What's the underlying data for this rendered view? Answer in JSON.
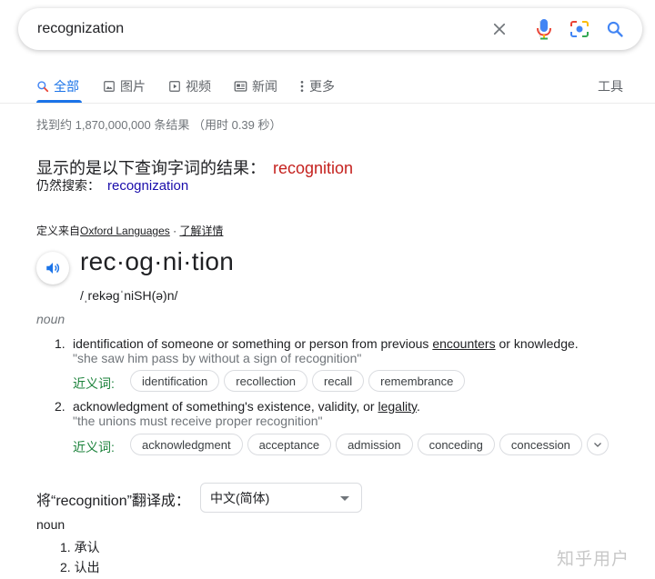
{
  "search": {
    "query": "recognization"
  },
  "tabs": [
    {
      "label": "全部",
      "icon": "search-icon",
      "active": true
    },
    {
      "label": "图片",
      "icon": "image-icon"
    },
    {
      "label": "视频",
      "icon": "video-icon"
    },
    {
      "label": "新闻",
      "icon": "news-icon"
    },
    {
      "label": "更多",
      "icon": "more-icon"
    }
  ],
  "tools_label": "工具",
  "result_stats": "找到约 1,870,000,000 条结果 （用时 0.39 秒）",
  "spelling": {
    "showing_prefix": "显示的是以下查询字词的结果：",
    "corrected": "recognition",
    "still_prefix": "仍然搜索：",
    "original": "recognization"
  },
  "dictionary": {
    "source_prefix": "定义来自",
    "source_link": "Oxford Languages",
    "sep": " · ",
    "more_link": "了解详情",
    "headword": "rec·og·ni·tion",
    "phonetic": "/ˌrekəɡˈniSH(ə)n/",
    "pos": "noun",
    "senses": [
      {
        "num": "1.",
        "def_before": "identification of someone or something or person from previous ",
        "def_link": "encounters",
        "def_after": " or knowledge.",
        "example": "\"she saw him pass by without a sign of recognition\"",
        "syn_label": "近义词:",
        "synonyms": [
          "identification",
          "recollection",
          "recall",
          "remembrance"
        ]
      },
      {
        "num": "2.",
        "def_before": "acknowledgment of something's existence, validity, or ",
        "def_link": "legality",
        "def_after": ".",
        "example": "\"the unions must receive proper recognition\"",
        "syn_label": "近义词:",
        "synonyms": [
          "acknowledgment",
          "acceptance",
          "admission",
          "conceding",
          "concession"
        ]
      }
    ]
  },
  "translate": {
    "label": "将“recognition”翻译成：",
    "language": "中文(简体)",
    "pos": "noun",
    "items": [
      "1. 承认",
      "2. 认出"
    ]
  },
  "watermark": "知乎用户",
  "colors": {
    "accent": "#1a73e8",
    "correction": "#c5221f",
    "link": "#1a0dab",
    "synonym_label": "#188038"
  }
}
